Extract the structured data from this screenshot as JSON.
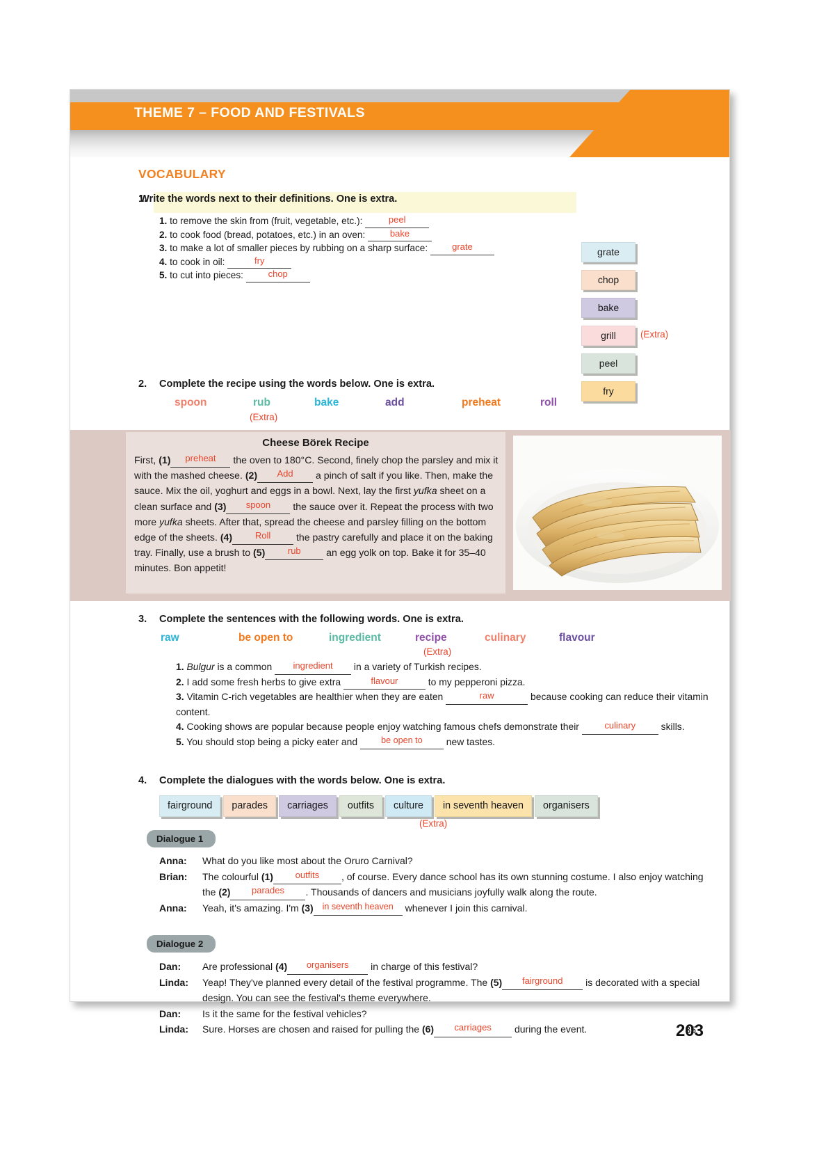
{
  "header": {
    "title": "THEME 7 – FOOD AND FESTIVALS",
    "accent_color": "#f5901e"
  },
  "section_title": "VOCABULARY",
  "page_number": "35",
  "book_page_number": "203",
  "extra_label": "(Extra)",
  "exercise1": {
    "number": "1.",
    "instruction": "Write the words next to their definitions. One is extra.",
    "items": [
      {
        "num": "1.",
        "text": "to remove the skin from (fruit, vegetable, etc.):",
        "answer": "peel"
      },
      {
        "num": "2.",
        "text": "to cook food (bread, potatoes, etc.) in an oven:",
        "answer": "bake"
      },
      {
        "num": "3.",
        "text": "to make a lot of smaller pieces by rubbing on a sharp surface:",
        "answer": "grate"
      },
      {
        "num": "4.",
        "text": "to cook in oil:",
        "answer": "fry"
      },
      {
        "num": "5.",
        "text": "to cut into pieces:",
        "answer": "chop"
      }
    ],
    "chips": [
      {
        "label": "grate",
        "color": "#daedf3"
      },
      {
        "label": "chop",
        "color": "#fadfcc"
      },
      {
        "label": "bake",
        "color": "#cfc9e2"
      },
      {
        "label": "grill",
        "color": "#fbdcdc"
      },
      {
        "label": "peel",
        "color": "#d8e4dc"
      },
      {
        "label": "fry",
        "color": "#fcdc9e"
      }
    ],
    "extra_chip_index": 3
  },
  "exercise2": {
    "number": "2.",
    "instruction": "Complete the recipe using the words below. One is extra.",
    "words": [
      {
        "label": "spoon",
        "color": "#f0806a"
      },
      {
        "label": "rub",
        "color": "#5bb9a4"
      },
      {
        "label": "bake",
        "color": "#2cb5d8"
      },
      {
        "label": "add",
        "color": "#6b4fa0"
      },
      {
        "label": "preheat",
        "color": "#f0791e"
      },
      {
        "label": "roll",
        "color": "#8f4fa8"
      }
    ],
    "extra_word": "bake",
    "recipe_title": "Cheese Börek Recipe",
    "recipe_parts": {
      "p1": "First, ",
      "n1": "(1)",
      "a1": "preheat",
      "p2": " the oven to 180°C. Second, finely chop the parsley and mix it with the mashed cheese. ",
      "n2": "(2)",
      "a2": "Add",
      "p3": " a pinch of salt if you like. Then, make the sauce. Mix the oil, yoghurt and eggs in a bowl. Next, lay the first ",
      "it1": "yufka",
      "p4": " sheet on a clean surface and ",
      "n3": "(3)",
      "a3": "spoon",
      "p5": " the sauce over it. Repeat the process with two more ",
      "it2": "yufka",
      "p6": " sheets. After that, spread the cheese and parsley filling on the bottom edge of the sheets. ",
      "n4": "(4)",
      "a4": "Roll",
      "p7": " the pastry carefully and place it on the baking tray. Finally, use a brush to ",
      "n5": "(5)",
      "a5": "rub",
      "p8": " an egg yolk on top. Bake it for 35–40 minutes. Bon appetit!"
    },
    "photo_alt": "cheese börek pastry rolls on a white plate"
  },
  "exercise3": {
    "number": "3.",
    "instruction": "Complete the sentences with the following words. One is extra.",
    "words": [
      {
        "label": "raw",
        "color": "#2cb5d8"
      },
      {
        "label": "be open to",
        "color": "#f0791e"
      },
      {
        "label": "ingredient",
        "color": "#5bb9a4"
      },
      {
        "label": "recipe",
        "color": "#8f4fa8"
      },
      {
        "label": "culinary",
        "color": "#f0806a"
      },
      {
        "label": "flavour",
        "color": "#6b4fa0"
      }
    ],
    "extra_word": "recipe",
    "sentences": [
      {
        "num": "1.",
        "italic_lead": "Bulgur",
        "pre": " is a common ",
        "answer": "ingredient",
        "post": " in a variety of Turkish recipes."
      },
      {
        "num": "2.",
        "italic_lead": "",
        "pre": "I add some fresh herbs to give extra ",
        "answer": "flavour",
        "post": " to my pepperoni pizza."
      },
      {
        "num": "3.",
        "italic_lead": "",
        "pre": "Vitamin C-rich vegetables are healthier when they are eaten ",
        "answer": "raw",
        "post": " because cooking can reduce their vitamin content."
      },
      {
        "num": "4.",
        "italic_lead": "",
        "pre": "Cooking shows are popular because people enjoy watching famous chefs demonstrate their ",
        "answer": "culinary",
        "post": " skills."
      },
      {
        "num": "5.",
        "italic_lead": "",
        "pre": "You should stop being a picky eater and ",
        "answer": "be open to",
        "post": " new tastes."
      }
    ]
  },
  "exercise4": {
    "number": "4.",
    "instruction": "Complete the dialogues with the words below. One is extra.",
    "chips": [
      {
        "label": "fairground",
        "color": "#d8ecf3"
      },
      {
        "label": "parades",
        "color": "#fadfcc"
      },
      {
        "label": "carriages",
        "color": "#cfc9e2"
      },
      {
        "label": "outfits",
        "color": "#dde6d8"
      },
      {
        "label": "culture",
        "color": "#cfe9f5"
      },
      {
        "label": "in seventh heaven",
        "color": "#fce3ab"
      },
      {
        "label": "organisers",
        "color": "#d8e4dc"
      }
    ],
    "extra_chip_index": 4,
    "dialogue1": {
      "tag": "Dialogue 1",
      "lines": [
        {
          "speaker": "Anna:",
          "pre": "What do you like most about the Oruro Carnival?",
          "answer": "",
          "post": ""
        },
        {
          "speaker": "Brian:",
          "pre": "The colourful ",
          "num": "(1)",
          "answer": "outfits",
          "post": ", of course. Every dance school has its own stunning costume. I also enjoy watching the ",
          "num2": "(2)",
          "answer2": "parades",
          "post2": ". Thousands of dancers and musicians joyfully walk along the route."
        },
        {
          "speaker": "Anna:",
          "pre": "Yeah, it's amazing. I'm ",
          "num": "(3)",
          "answer": "in seventh heaven",
          "post": " whenever I join this carnival."
        }
      ]
    },
    "dialogue2": {
      "tag": "Dialogue 2",
      "lines": [
        {
          "speaker": "Dan:",
          "pre": "Are professional ",
          "num": "(4)",
          "answer": "organisers",
          "post": " in charge of this festival?"
        },
        {
          "speaker": "Linda:",
          "pre": "Yeap! They've planned every detail of the festival programme. The ",
          "num": "(5)",
          "answer": "fairground",
          "post": " is decorated with a special design. You can see the festival's theme everywhere."
        },
        {
          "speaker": "Dan:",
          "pre": "Is it the same for the festival vehicles?",
          "answer": "",
          "post": ""
        },
        {
          "speaker": "Linda:",
          "pre": "Sure. Horses are chosen and raised for pulling the ",
          "num": "(6)",
          "answer": "carriages",
          "post": " during the event."
        }
      ]
    }
  }
}
